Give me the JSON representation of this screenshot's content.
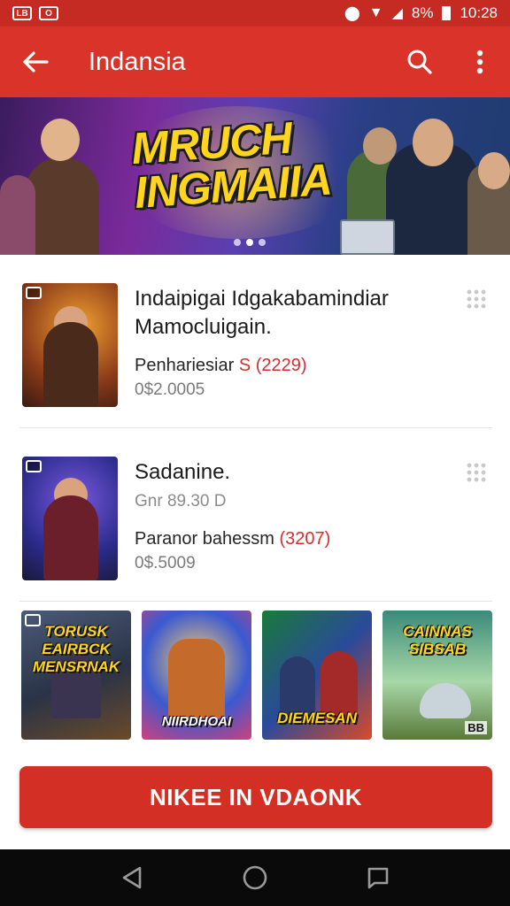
{
  "status_bar": {
    "badge_1": "LB",
    "badge_2": "O",
    "battery": "8%",
    "time": "10:28"
  },
  "app_bar": {
    "title": "Indansia"
  },
  "banner": {
    "title": "MRUCH INGMAIIA",
    "slides": 3,
    "active_slide": 1
  },
  "items": [
    {
      "title": "Indaipigai Idgakabamindiar Mamocluigain.",
      "subtitle": "",
      "rating_label": "Penhariesiar",
      "rating_icon": "S",
      "rating_count": "(2229)",
      "price": "0$2.0005",
      "thumb_colors": [
        "#6a2f17",
        "#e07a22",
        "#3a1f17"
      ]
    },
    {
      "title": "Sadanine.",
      "subtitle": "Gnr 89.30 D",
      "rating_label": "Paranor bahessm",
      "rating_icon": "",
      "rating_count": "(3207)",
      "price": "0$.5009",
      "thumb_colors": [
        "#1f2c7a",
        "#6a3fd0",
        "#4a1f2a"
      ]
    }
  ],
  "grid": [
    {
      "label": "TORUSK EAIRBCK MENSRNAK",
      "colors": [
        "#3f4a62",
        "#c27a3a"
      ],
      "corner": ""
    },
    {
      "label": "NIIRDHOAI",
      "colors": [
        "#2d4fc4",
        "#e94a7a"
      ],
      "corner": ""
    },
    {
      "label": "DIEMESAN",
      "colors": [
        "#1a6f3a",
        "#d1442a"
      ],
      "corner": ""
    },
    {
      "label": "CAINNAS SIBSAB",
      "colors": [
        "#2f7f74",
        "#9fd1a8"
      ],
      "corner": "BB"
    }
  ],
  "install": {
    "label": "NIKEE IN VDAONK"
  },
  "colors": {
    "primary": "#d9332a",
    "accent": "#d32f2f"
  }
}
